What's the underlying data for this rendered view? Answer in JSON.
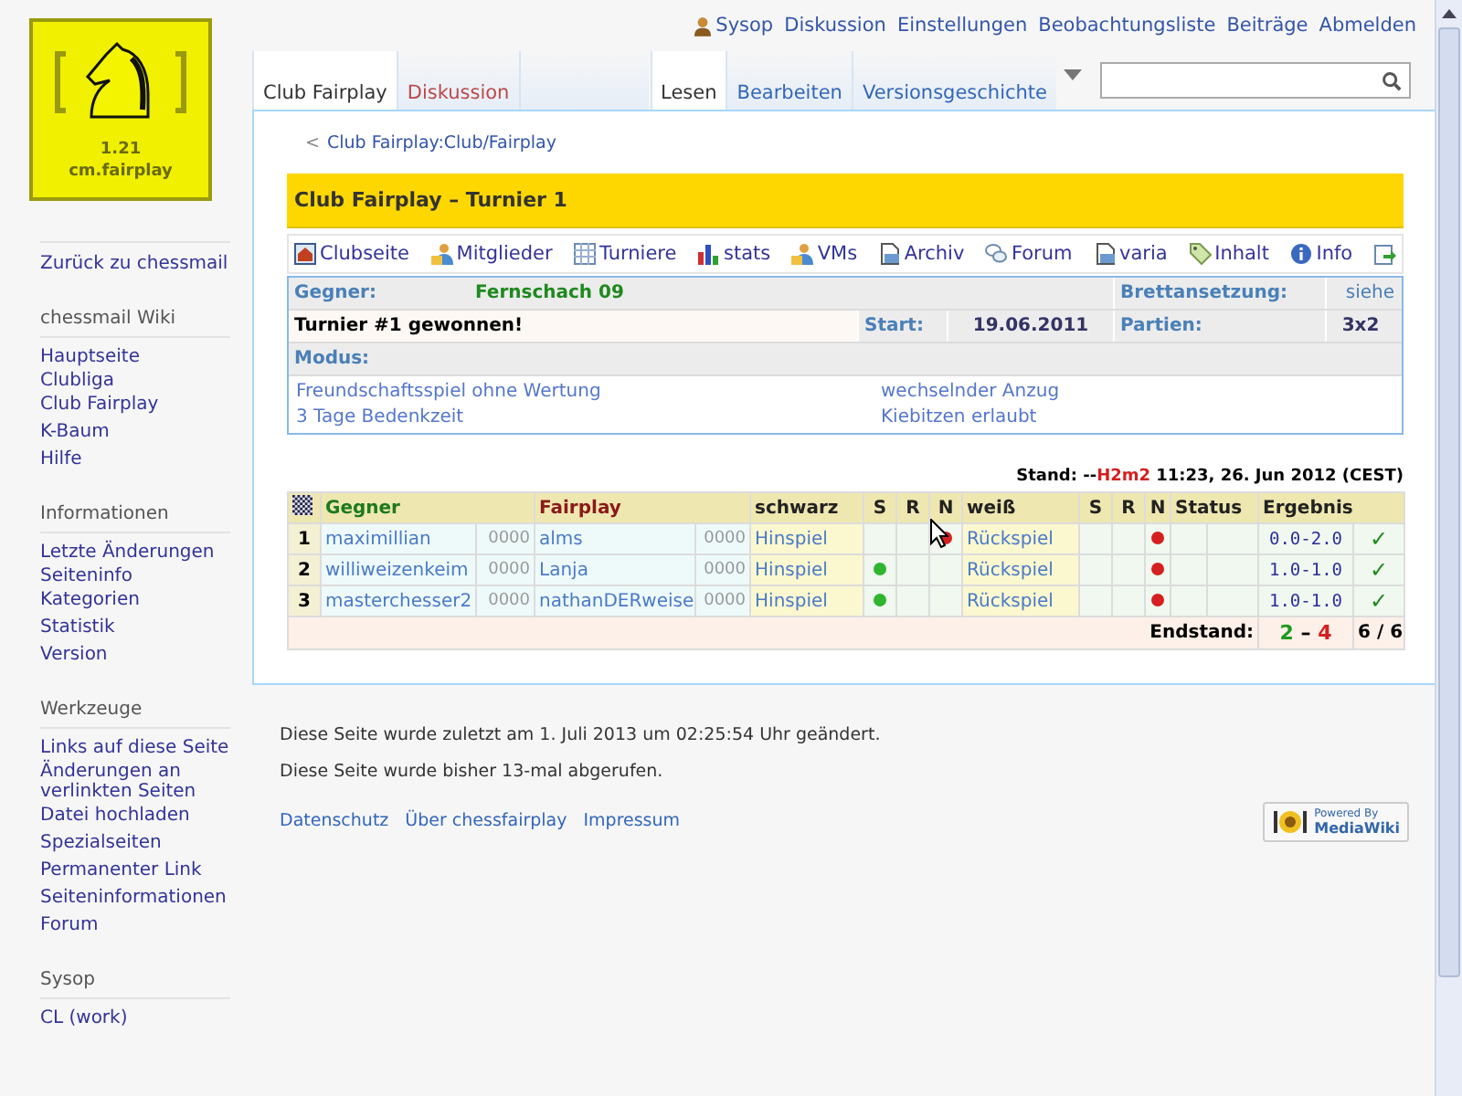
{
  "logo": {
    "version": "1.21",
    "name": "cm.fairplay"
  },
  "personal": [
    {
      "label": "Sysop",
      "kind": "user"
    },
    {
      "label": "Diskussion",
      "kind": "link"
    },
    {
      "label": "Einstellungen",
      "kind": "link"
    },
    {
      "label": "Beobachtungsliste",
      "kind": "link"
    },
    {
      "label": "Beiträge",
      "kind": "link"
    },
    {
      "label": "Abmelden",
      "kind": "link"
    }
  ],
  "left_tabs": [
    {
      "label": "Club Fairplay",
      "selected": true,
      "missing": false
    },
    {
      "label": "Diskussion",
      "selected": false,
      "missing": true
    }
  ],
  "right_tabs": [
    {
      "label": "Lesen",
      "selected": true
    },
    {
      "label": "Bearbeiten",
      "selected": false
    },
    {
      "label": "Versionsgeschichte",
      "selected": false
    }
  ],
  "breadcrumb": {
    "arrow": "<",
    "label": "Club Fairplay:Club/Fairplay"
  },
  "title": "Club Fairplay – Turnier 1",
  "toolbar": [
    {
      "label": "Clubseite",
      "kind": "house"
    },
    {
      "label": "Mitglieder",
      "kind": "people"
    },
    {
      "label": "Turniere",
      "kind": "table"
    },
    {
      "label": "stats",
      "kind": "chart"
    },
    {
      "label": "VMs",
      "kind": "people"
    },
    {
      "label": "Archiv",
      "kind": "document"
    },
    {
      "label": "Forum",
      "kind": "bubbles"
    },
    {
      "label": "varia",
      "kind": "document"
    },
    {
      "label": "Inhalt",
      "kind": "tag"
    },
    {
      "label": "Info",
      "kind": "info"
    },
    {
      "kind": "export"
    }
  ],
  "info": {
    "opponent_label": "Gegner:",
    "opponent": "Fernschach 09",
    "board_label": "Brettansetzung:",
    "board": "siehe",
    "result_text": "Turnier #1 gewonnen!",
    "start_label": "Start:",
    "start": "19.06.2011",
    "games_label": "Partien:",
    "games": "3x2",
    "mode_label": "Modus:",
    "modes": [
      "Freundschaftsspiel ohne Wertung",
      "wechselnder Anzug",
      "3 Tage Bedenkzeit",
      "Kiebitzen erlaubt"
    ]
  },
  "stand": {
    "prefix": "Stand: --",
    "user": "H2m2",
    "suffix": " 11:23, 26. Jun 2012 (CEST)"
  },
  "table": {
    "columns": [
      "Gegner",
      "Fairplay",
      "schwarz",
      "S",
      "R",
      "N",
      "weiß",
      "S",
      "R",
      "N",
      "Status",
      "Ergebnis"
    ],
    "rows": [
      {
        "number": "1",
        "opponent": "maximillian",
        "opponent_rating": "0000",
        "player": "alms",
        "player_rating": "0000",
        "first": {
          "label": "Hinspiel",
          "win": false,
          "loss": true
        },
        "second": {
          "label": "Rückspiel",
          "win": false,
          "loss": true
        },
        "result": "0.0-2.0",
        "done": "✓"
      },
      {
        "number": "2",
        "opponent": "williweizenkeim",
        "opponent_rating": "0000",
        "player": "Lanja",
        "player_rating": "0000",
        "first": {
          "label": "Hinspiel",
          "win": true,
          "loss": false
        },
        "second": {
          "label": "Rückspiel",
          "win": false,
          "loss": true
        },
        "result": "1.0-1.0",
        "done": "✓"
      },
      {
        "number": "3",
        "opponent": "masterchesser2",
        "opponent_rating": "0000",
        "player": "nathanDERweise",
        "player_rating": "0000",
        "first": {
          "label": "Hinspiel",
          "win": true,
          "loss": false
        },
        "second": {
          "label": "Rückspiel",
          "win": false,
          "loss": true
        },
        "result": "1.0-1.0",
        "done": "✓"
      }
    ],
    "final_label": "Endstand:",
    "score_win": "2",
    "score_sep": "–",
    "score_loss": "4",
    "games_done": "6 / 6"
  },
  "sidebar": [
    {
      "items": [
        "Zurück zu chessmail"
      ]
    },
    {
      "heading": "chessmail Wiki",
      "items": [
        "Hauptseite",
        "Clubliga",
        "Club Fairplay",
        "K-Baum",
        "Hilfe"
      ]
    },
    {
      "heading": "Informationen",
      "items": [
        "Letzte Änderungen",
        "Seiteninfo",
        "Kategorien",
        "Statistik",
        "Version"
      ]
    },
    {
      "heading": "Werkzeuge",
      "items": [
        "Links auf diese Seite",
        "Änderungen an verlinkten Seiten",
        "Datei hochladen",
        "Spezialseiten",
        "Permanenter Link",
        "Seiteninformationen",
        "Forum"
      ]
    },
    {
      "heading": "Sysop",
      "items": [
        "CL (work)"
      ]
    }
  ],
  "footer": {
    "lines": [
      "Diese Seite wurde zuletzt am 1. Juli 2013 um 02:25:54 Uhr geändert.",
      "Diese Seite wurde bisher 13-mal abgerufen."
    ],
    "links": [
      "Datenschutz",
      "Über chessfairplay",
      "Impressum"
    ],
    "badge": {
      "top": "Powered By",
      "bottom": "MediaWiki"
    }
  }
}
